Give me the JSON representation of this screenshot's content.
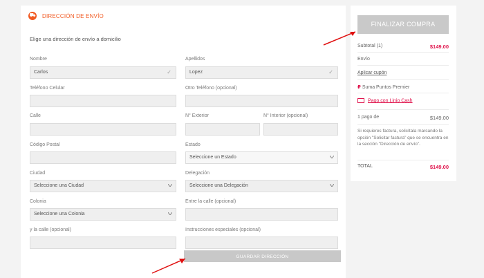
{
  "address": {
    "header_title": "DIRECCIÓN DE ENVÍO",
    "subtitle": "Elige una dirección de envío a domicilio",
    "fields": {
      "nombre": {
        "label": "Nombre",
        "value": "Carlos"
      },
      "apellidos": {
        "label": "Apellidos",
        "value": "Lopez"
      },
      "telefono_celular": {
        "label": "Teléfono Celular",
        "value": ""
      },
      "otro_telefono": {
        "label": "Otro Teléfono (opcional)",
        "value": ""
      },
      "calle": {
        "label": "Calle",
        "value": ""
      },
      "no_exterior": {
        "label": "N° Exterior",
        "value": ""
      },
      "no_interior": {
        "label": "N° Interior (opcional)",
        "value": ""
      },
      "codigo_postal": {
        "label": "Código Postal",
        "value": ""
      },
      "estado": {
        "label": "Estado",
        "value": "Seleccione un Estado"
      },
      "ciudad": {
        "label": "Ciudad",
        "value": "Seleccione una Ciudad"
      },
      "delegacion": {
        "label": "Delegación",
        "value": "Seleccione una Delegación"
      },
      "colonia": {
        "label": "Colonia",
        "value": "Seleccione una Colonia"
      },
      "entre_calle": {
        "label": "Entre la calle (opcional)",
        "value": ""
      },
      "y_calle": {
        "label": "y la calle (opcional)",
        "value": ""
      },
      "instrucciones": {
        "label": "Instrucciones especiales (opcional)",
        "value": ""
      }
    },
    "save_label": "GUARDAR DIRECCIÓN"
  },
  "summary": {
    "finish_label": "FINALIZAR COMPRA",
    "subtotal_label": "Subtotal (1)",
    "subtotal_value": "$149.00",
    "envio_label": "Envío",
    "coupon_label": "Aplicar cupón",
    "points_label": "Suma Puntos Premier",
    "linio_cash_label": "Pago con Linio Cash",
    "payments_label": "1 pago de",
    "payments_value": "$149.00",
    "invoice_note": "Si requieres factura, solicítala marcando la opción \"Solicitar factura\" que se encuentra en la sección \"Dirección de envío\".",
    "total_label": "TOTAL",
    "total_value": "$149.00"
  },
  "colors": {
    "accent": "#f15a22",
    "price": "#e0144c",
    "arrow": "#e01010",
    "button_disabled": "#c8c8c8"
  }
}
